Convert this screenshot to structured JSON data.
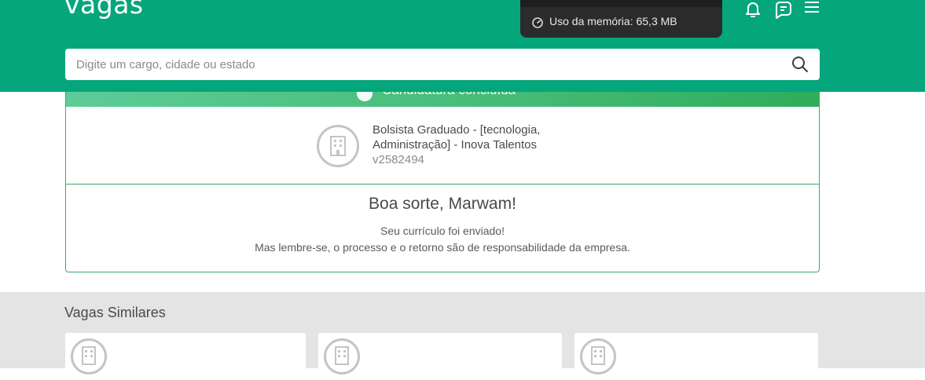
{
  "header": {
    "logo_text": "vagas",
    "background_color": "#05a67c",
    "icons": [
      "bell-icon",
      "chat-icon",
      "menu-icon"
    ]
  },
  "tooltip": {
    "icon": "gauge-icon",
    "text": "Uso da memória: 65,3 MB"
  },
  "search": {
    "placeholder": "Digite um cargo, cidade ou estado",
    "value": "",
    "icon": "search-icon"
  },
  "status_banner": {
    "text": "Candidatura concluída",
    "icon": "check-circle-icon"
  },
  "job": {
    "title": "Bolsista Graduado - [tecnologia, Administração] - Inova Talentos",
    "code": "v2582494",
    "logo_icon": "building-icon"
  },
  "confirmation": {
    "heading": "Boa sorte, Marwam!",
    "line1": "Seu currículo foi enviado!",
    "line2": "Mas lembre-se, o processo e o retorno são de responsabilidade da empresa."
  },
  "similar": {
    "title": "Vagas Similares",
    "cards": [
      {
        "logo_icon": "building-icon"
      },
      {
        "logo_icon": "building-icon"
      },
      {
        "logo_icon": "building-icon"
      }
    ]
  },
  "colors": {
    "brand_green": "#05a67c",
    "border_green": "#3aa86a",
    "section_gray": "#e4e4e4"
  }
}
